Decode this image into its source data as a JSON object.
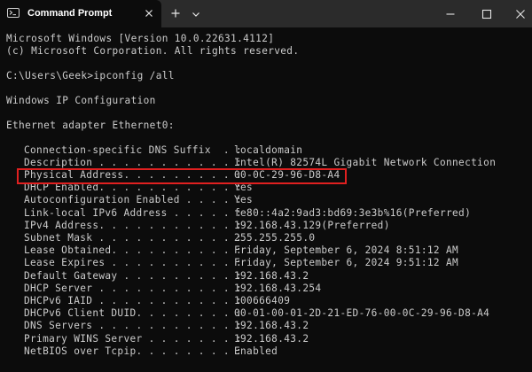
{
  "window": {
    "tab_title": "Command Prompt"
  },
  "console": {
    "banner_line1": "Microsoft Windows [Version 10.0.22631.4112]",
    "banner_line2": "(c) Microsoft Corporation. All rights reserved.",
    "prompt_command": "C:\\Users\\Geek>ipconfig /all",
    "ip_config_header": "Windows IP Configuration",
    "adapter_header": "Ethernet adapter Ethernet0:",
    "rows": [
      {
        "label": "Connection-specific DNS Suffix  . :",
        "value": "localdomain"
      },
      {
        "label": "Description . . . . . . . . . . . :",
        "value": "Intel(R) 82574L Gigabit Network Connection"
      },
      {
        "label": "Physical Address. . . . . . . . . :",
        "value": "00-0C-29-96-D8-A4"
      },
      {
        "label": "DHCP Enabled. . . . . . . . . . . :",
        "value": "Yes"
      },
      {
        "label": "Autoconfiguration Enabled . . . . :",
        "value": "Yes"
      },
      {
        "label": "Link-local IPv6 Address . . . . . :",
        "value": "fe80::4a2:9ad3:bd69:3e3b%16(Preferred)"
      },
      {
        "label": "IPv4 Address. . . . . . . . . . . :",
        "value": "192.168.43.129(Preferred)"
      },
      {
        "label": "Subnet Mask . . . . . . . . . . . :",
        "value": "255.255.255.0"
      },
      {
        "label": "Lease Obtained. . . . . . . . . . :",
        "value": "Friday, September 6, 2024 8:51:12 AM"
      },
      {
        "label": "Lease Expires . . . . . . . . . . :",
        "value": "Friday, September 6, 2024 9:51:12 AM"
      },
      {
        "label": "Default Gateway . . . . . . . . . :",
        "value": "192.168.43.2"
      },
      {
        "label": "DHCP Server . . . . . . . . . . . :",
        "value": "192.168.43.254"
      },
      {
        "label": "DHCPv6 IAID . . . . . . . . . . . :",
        "value": "100666409"
      },
      {
        "label": "DHCPv6 Client DUID. . . . . . . . :",
        "value": "00-01-00-01-2D-21-ED-76-00-0C-29-96-D8-A4"
      },
      {
        "label": "DNS Servers . . . . . . . . . . . :",
        "value": "192.168.43.2"
      },
      {
        "label": "Primary WINS Server . . . . . . . :",
        "value": "192.168.43.2"
      },
      {
        "label": "NetBIOS over Tcpip. . . . . . . . :",
        "value": "Enabled"
      }
    ]
  },
  "icons": {
    "tab": "terminal-icon",
    "tab_close": "close-icon",
    "new_tab": "plus-icon",
    "dropdown": "chevron-down-icon",
    "minimize": "minimize-icon",
    "maximize": "maximize-icon",
    "close": "close-icon"
  },
  "colors": {
    "background": "#0c0c0c",
    "titlebar": "#2b2b2b",
    "text": "#cccccc",
    "highlight": "#e02020"
  }
}
